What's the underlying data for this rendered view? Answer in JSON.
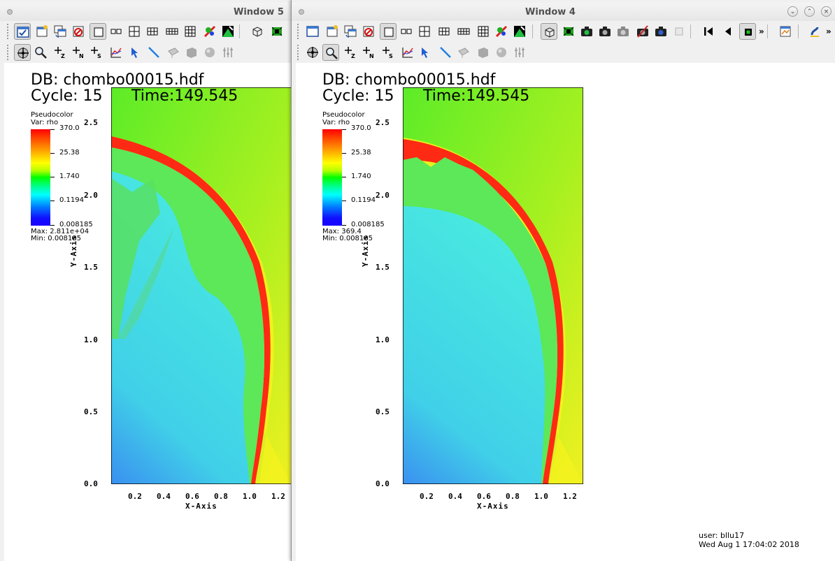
{
  "windows": [
    {
      "id": "window5",
      "title": "Window 5",
      "db_label": "DB: chombo00015.hdf",
      "cycle_label": "Cycle: 15",
      "time_label": "Time:149.545",
      "legend": {
        "plot_type": "Pseudocolor",
        "var_label": "Var: rho",
        "ticks": [
          "370.0",
          "25.38",
          "1.740",
          "0.1194",
          "0.008185"
        ],
        "max_label": "Max:  2.811e+04",
        "min_label": "Min:  0.008185"
      },
      "x_axis_label": "X-Axis",
      "y_axis_label": "Y-Axis",
      "x_ticks": [
        "0.2",
        "0.4",
        "0.6",
        "0.8",
        "1.0",
        "1.2"
      ],
      "y_ticks": [
        "2.5",
        "2.0",
        "1.5",
        "1.0",
        "0.5",
        "0.0"
      ]
    },
    {
      "id": "window4",
      "title": "Window 4",
      "db_label": "DB: chombo00015.hdf",
      "cycle_label": "Cycle: 15",
      "time_label": "Time:149.545",
      "legend": {
        "plot_type": "Pseudocolor",
        "var_label": "Var: rho",
        "ticks": [
          "370.0",
          "25.38",
          "1.740",
          "0.1194",
          "0.008185"
        ],
        "max_label": "Max:  369.4",
        "min_label": "Min:  0.008185"
      },
      "x_axis_label": "X-Axis",
      "y_axis_label": "Y-Axis",
      "x_ticks": [
        "0.2",
        "0.4",
        "0.6",
        "0.8",
        "1.0",
        "1.2"
      ],
      "y_ticks": [
        "2.5",
        "2.0",
        "1.5",
        "1.0",
        "0.5",
        "0.0"
      ],
      "user_label": "user: bllu17",
      "date_label": "Wed Aug  1 17:04:02 2018"
    }
  ],
  "toolbar_overflow": "»",
  "colors": {
    "window_bg": "#f0f0f0",
    "canvas_bg": "#ffffff",
    "shock_red": "#ff2010",
    "background_green": "#6ef020",
    "interior_cyan": "#40e0e0",
    "ambient_yellow": "#f0f020"
  }
}
